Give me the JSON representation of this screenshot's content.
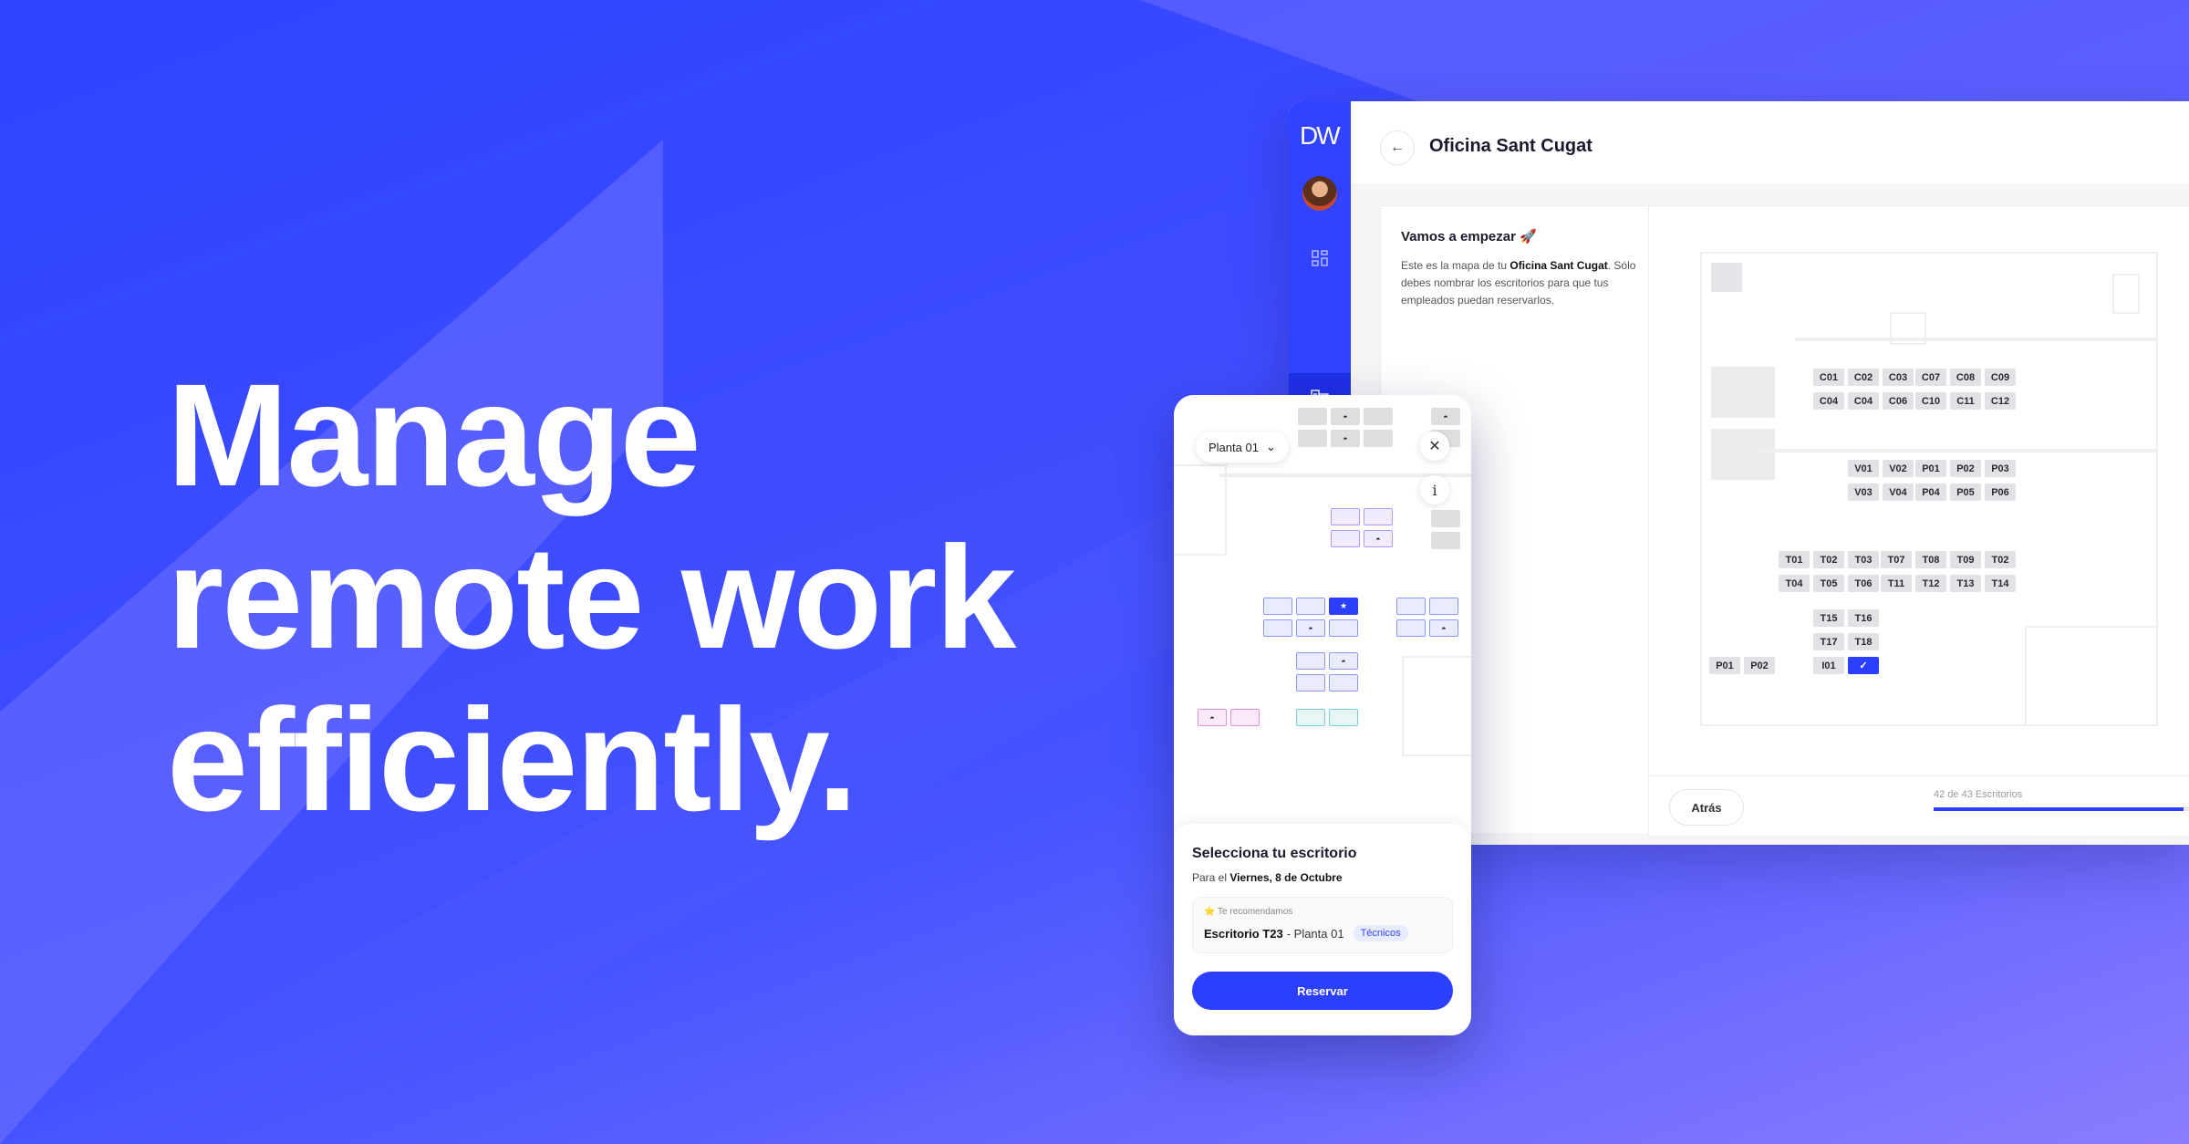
{
  "hero": {
    "line1": "Manage",
    "line2": "remote work",
    "line3": "efficiently."
  },
  "desktop": {
    "logo": "DW",
    "nav_icons": [
      "dashboard-icon",
      "office-icon",
      "team-icon",
      "home-icon"
    ],
    "back_icon": "←",
    "office_title": "Oficina Sant Cugat",
    "panel": {
      "title": "Vamos a empezar 🚀",
      "desc_pre": "Este es la mapa de tu ",
      "desc_bold": "Oficina Sant Cugat",
      "desc_post": ". Sólo debes nombrar los escritorios para que tus empleados puedan reservarlos."
    },
    "back_label": "Atrás",
    "progress_label": "42 de 43 Escritorios",
    "progress_fraction": 0.977,
    "desks": [
      "C01",
      "C02",
      "C03",
      "C07",
      "C08",
      "C09",
      "C04",
      "C04",
      "C06",
      "C10",
      "C11",
      "C12",
      "V01",
      "V02",
      "V03",
      "V04",
      "P01",
      "P02",
      "P03",
      "P04",
      "P05",
      "P06",
      "T01",
      "T02",
      "T03",
      "T07",
      "T08",
      "T09",
      "T02",
      "T04",
      "T05",
      "T06",
      "T11",
      "T12",
      "T13",
      "T14",
      "T15",
      "T16",
      "T17",
      "T18",
      "P01",
      "P02",
      "I01",
      "✓"
    ],
    "accent": "#2c3fff"
  },
  "mobile": {
    "floor_label": "Planta 01",
    "chevron": "⌄",
    "close_icon": "✕",
    "info_icon": "i",
    "sheet_title": "Selecciona tu escritorio",
    "date_pre": "Para el ",
    "date_bold": "Viernes, 8 de Octubre",
    "rec_label": "⭐ Te recomendamos",
    "rec_desk": "Escritorio T23",
    "rec_floor": " - Planta 01",
    "rec_chip": "Técnicos",
    "reserve_label": "Reservar"
  }
}
